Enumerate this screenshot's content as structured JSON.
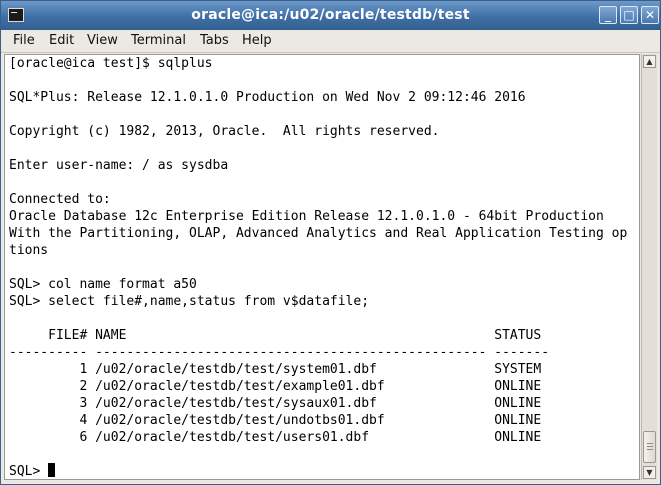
{
  "window": {
    "title": "oracle@ica:/u02/oracle/testdb/test",
    "icon": "terminal-icon",
    "controls": {
      "minimize": "_",
      "maximize": "□",
      "close": "✕"
    }
  },
  "menu": {
    "file": "File",
    "edit": "Edit",
    "view": "View",
    "terminal": "Terminal",
    "tabs": "Tabs",
    "help": "Help"
  },
  "terminal": {
    "lines": [
      "[oracle@ica test]$ sqlplus",
      "",
      "SQL*Plus: Release 12.1.0.1.0 Production on Wed Nov 2 09:12:46 2016",
      "",
      "Copyright (c) 1982, 2013, Oracle.  All rights reserved.",
      "",
      "Enter user-name: / as sysdba",
      "",
      "Connected to:",
      "Oracle Database 12c Enterprise Edition Release 12.1.0.1.0 - 64bit Production",
      "With the Partitioning, OLAP, Advanced Analytics and Real Application Testing op",
      "tions",
      "",
      "SQL> col name format a50",
      "SQL> select file#,name,status from v$datafile;",
      "",
      "     FILE# NAME                                               STATUS",
      "---------- -------------------------------------------------- -------",
      "         1 /u02/oracle/testdb/test/system01.dbf               SYSTEM",
      "         2 /u02/oracle/testdb/test/example01.dbf              ONLINE",
      "         3 /u02/oracle/testdb/test/sysaux01.dbf               ONLINE",
      "         4 /u02/oracle/testdb/test/undotbs01.dbf              ONLINE",
      "         6 /u02/oracle/testdb/test/users01.dbf                ONLINE",
      "",
      "SQL> "
    ]
  },
  "colors": {
    "titlebar": "#3f6fa6",
    "terminal_bg": "#ffffff",
    "terminal_fg": "#000000"
  }
}
